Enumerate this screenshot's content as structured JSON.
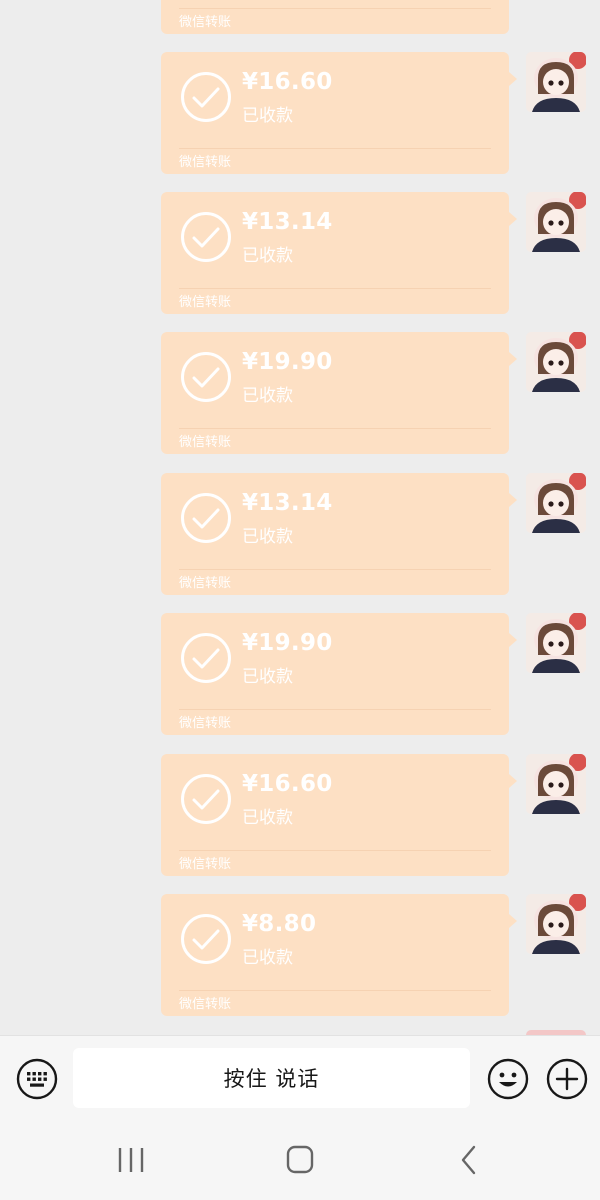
{
  "chat": {
    "partial_card": {
      "footer": "微信转账"
    },
    "messages": [
      {
        "amount": "¥16.60",
        "status": "已收款",
        "footer": "微信转账"
      },
      {
        "amount": "¥13.14",
        "status": "已收款",
        "footer": "微信转账"
      },
      {
        "amount": "¥19.90",
        "status": "已收款",
        "footer": "微信转账"
      },
      {
        "amount": "¥13.14",
        "status": "已收款",
        "footer": "微信转账"
      },
      {
        "amount": "¥19.90",
        "status": "已收款",
        "footer": "微信转账"
      },
      {
        "amount": "¥16.60",
        "status": "已收款",
        "footer": "微信转账"
      },
      {
        "amount": "¥8.80",
        "status": "已收款",
        "footer": "微信转账"
      }
    ]
  },
  "input_bar": {
    "voice_label": "按住 说话",
    "left_icon": "keyboard-icon",
    "emoji_icon": "emoji-icon",
    "plus_icon": "plus-icon"
  },
  "nav": {
    "recent_icon": "recent-apps-icon",
    "home_icon": "home-icon",
    "back_icon": "back-icon"
  },
  "colors": {
    "card_bg": "#fde0c4",
    "chat_bg": "#ededed",
    "text_on_card": "#ffffff"
  }
}
